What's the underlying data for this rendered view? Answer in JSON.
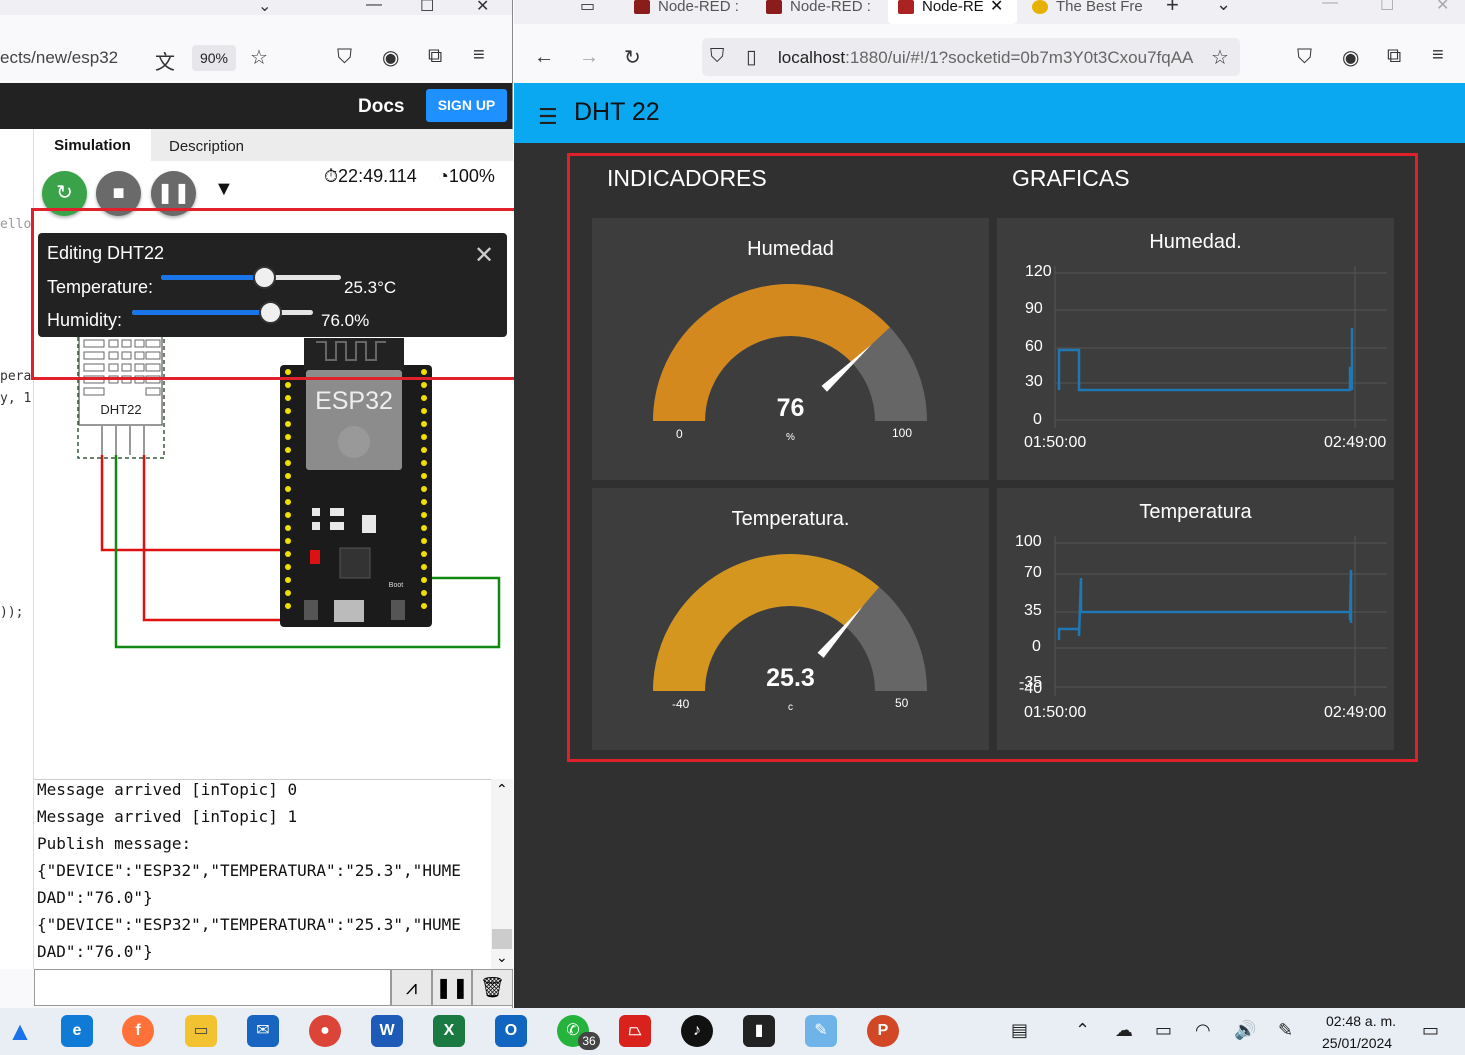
{
  "left_browser": {
    "url_fragment": "ects/new/esp32",
    "zoom": "90%"
  },
  "wokwi": {
    "docs": "Docs",
    "signup": "SIGN UP",
    "tabs": [
      "Simulation",
      "Description"
    ],
    "timer": "22:49.114",
    "speed": "100%",
    "code_fragments": [
      "ello",
      "pera",
      "y, 1",
      "));"
    ],
    "editing": {
      "title": "Editing DHT22",
      "temperature_label": "Temperature:",
      "temperature_value": "25.3°C",
      "temperature_fraction": 0.57,
      "humidity_label": "Humidity:",
      "humidity_value": "76.0%",
      "humidity_fraction": 0.76
    },
    "parts": {
      "sensor": "DHT22",
      "board": "ESP32",
      "boot": "Boot"
    },
    "serial_lines": [
      "Message arrived [inTopic] 0",
      "Message arrived [inTopic] 1",
      "Publish message:",
      "{\"DEVICE\":\"ESP32\",\"TEMPERATURA\":\"25.3\",\"HUME",
      "DAD\":\"76.0\"}",
      "{\"DEVICE\":\"ESP32\",\"TEMPERATURA\":\"25.3\",\"HUME",
      "DAD\":\"76.0\"}"
    ]
  },
  "right_browser": {
    "tabs": [
      "Node-RED :",
      "Node-RED :",
      "Node-RE",
      "The Best Fre"
    ],
    "url_host": "localhost",
    "url_rest": ":1880/ui/#!/1?socketid=0b7m3Y0t3Cxou7fqAA"
  },
  "dashboard": {
    "title": "DHT 22",
    "groups": [
      "INDICADORES",
      "GRAFICAS"
    ],
    "gauges": [
      {
        "title": "Humedad",
        "value": "76",
        "unit": "%",
        "min": "0",
        "max": "100",
        "fraction": 0.76,
        "color": "#d4891e"
      },
      {
        "title": "Temperatura.",
        "value": "25.3",
        "unit": "c",
        "min": "-40",
        "max": "50",
        "fraction": 0.7256,
        "color": "#d4961e"
      }
    ],
    "charts": [
      {
        "title": "Humedad.",
        "yticks": [
          "120",
          "90",
          "60",
          "30",
          "0"
        ],
        "xticks": [
          "01:50:00",
          "02:49:00"
        ]
      },
      {
        "title": "Temperatura",
        "yticks": [
          "100",
          "70",
          "35",
          "0",
          "-35",
          "-40"
        ],
        "xticks": [
          "01:50:00",
          "02:49:00"
        ]
      }
    ]
  },
  "taskbar": {
    "time": "02:48 a. m.",
    "date": "25/01/2024",
    "whatsapp_badge": "36"
  },
  "chart_data": [
    {
      "type": "line",
      "title": "Humedad.",
      "x": [
        "01:50:00",
        "02:49:00"
      ],
      "ylim": [
        0,
        120
      ],
      "series": [
        {
          "values_description_points": [
            [
              0,
              60
            ],
            [
              0.08,
              60
            ],
            [
              0.08,
              25
            ],
            [
              0.99,
              25
            ],
            [
              0.99,
              45
            ],
            [
              1.0,
              76
            ]
          ]
        }
      ],
      "grid": true
    },
    {
      "type": "line",
      "title": "Temperatura",
      "x": [
        "01:50:00",
        "02:49:00"
      ],
      "ylim": [
        -40,
        100
      ],
      "series": [
        {
          "values_description_points": [
            [
              0,
              18
            ],
            [
              0.07,
              18
            ],
            [
              0.07,
              60
            ],
            [
              0.08,
              34
            ],
            [
              0.99,
              34
            ],
            [
              0.99,
              75
            ],
            [
              1.0,
              25
            ]
          ]
        }
      ],
      "grid": true
    }
  ]
}
